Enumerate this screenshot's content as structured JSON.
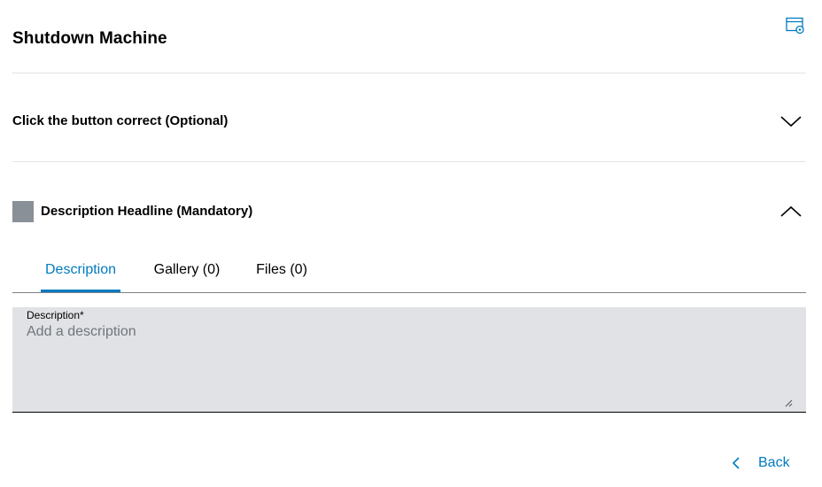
{
  "header": {
    "title": "Shutdown Machine",
    "settings_icon": "window-settings-icon"
  },
  "sections": [
    {
      "title": "Click the button correct (Optional)",
      "expanded": false,
      "chevron_icon": "chevron-down-icon"
    },
    {
      "title": "Description Headline (Mandatory)",
      "expanded": true,
      "chevron_icon": "chevron-up-icon",
      "status_color": "#8a9097"
    }
  ],
  "tabs": [
    {
      "label": "Description",
      "active": true
    },
    {
      "label": "Gallery (0)",
      "active": false
    },
    {
      "label": "Files (0)",
      "active": false
    }
  ],
  "description_field": {
    "label": "Description*",
    "placeholder": "Add a description",
    "value": ""
  },
  "footer": {
    "back_label": "Back",
    "back_icon": "chevron-left-icon"
  },
  "colors": {
    "accent": "#007bc0",
    "field_background": "#e0e2e5",
    "divider": "#e3e4e6"
  }
}
